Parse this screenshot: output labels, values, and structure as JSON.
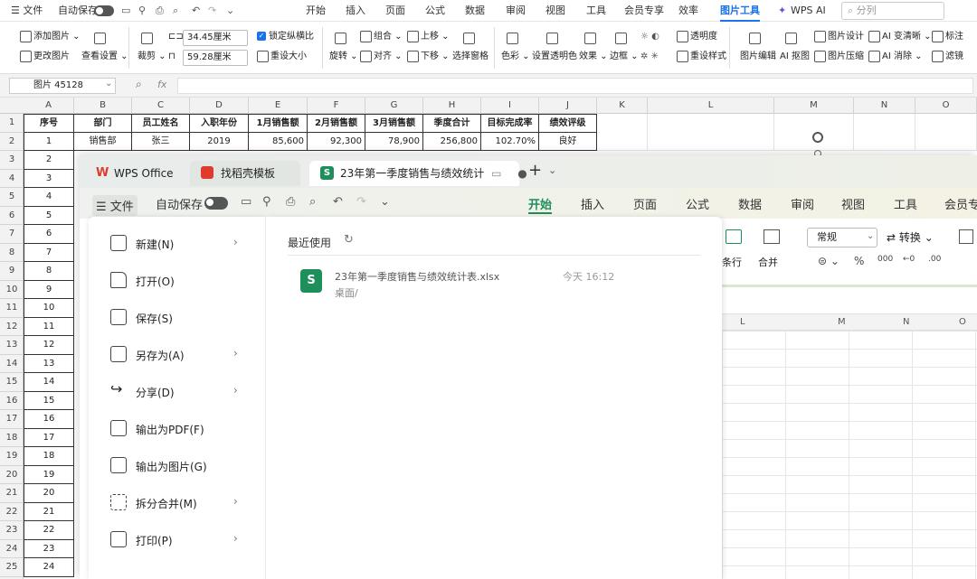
{
  "menubar": {
    "file": "☰ 文件",
    "autosave": "自动保存",
    "tabs": [
      "开始",
      "插入",
      "页面",
      "公式",
      "数据",
      "审阅",
      "视图",
      "工具",
      "会员专享",
      "效率",
      "图片工具",
      "WPS AI"
    ],
    "active_tab": "图片工具",
    "search_placeholder": "分列"
  },
  "ribbon": {
    "add_image": "添加图片",
    "change_image": "更改图片",
    "view_settings": "查看设置",
    "crop": "裁剪",
    "width_value": "34.45厘米",
    "height_value": "59.28厘米",
    "lock_ratio": "锁定纵横比",
    "reset_size": "重设大小",
    "rotate": "旋转",
    "group": "组合",
    "align": "对齐",
    "bring_up": "上移",
    "send_down": "下移",
    "selection_pane": "选择窗格",
    "color": "色彩",
    "set_transparent": "设置透明色",
    "effects": "效果",
    "border": "边框",
    "transparency": "透明度",
    "reset_style": "重设样式",
    "image_edit": "图片编辑",
    "ai_cutout": "AI 抠图",
    "image_design": "图片设计",
    "image_compress": "图片压缩",
    "ai_sharpen": "AI 变清晰",
    "ai_remove": "AI 消除",
    "annotate": "标注",
    "filter": "滤镜"
  },
  "formula_bar": {
    "name_box": "图片 45128",
    "fx": "fx"
  },
  "sheet": {
    "columns": [
      "A",
      "B",
      "C",
      "D",
      "E",
      "F",
      "G",
      "H",
      "I",
      "J",
      "K",
      "L",
      "M",
      "N",
      "O"
    ],
    "rows": [
      "1",
      "2",
      "3",
      "4",
      "5",
      "6",
      "7",
      "8",
      "9",
      "10",
      "11",
      "12",
      "13",
      "14",
      "15",
      "16",
      "17",
      "18",
      "19",
      "20",
      "21",
      "22",
      "23",
      "24",
      "25"
    ],
    "headers": [
      "序号",
      "部门",
      "员工姓名",
      "入职年份",
      "1月销售额",
      "2月销售额",
      "3月销售额",
      "季度合计",
      "目标完成率",
      "绩效评级"
    ],
    "row2": [
      "1",
      "销售部",
      "张三",
      "2019",
      "85,600",
      "92,300",
      "78,900",
      "256,800",
      "102.70%",
      "良好"
    ],
    "col_a": [
      "2",
      "3",
      "4",
      "5",
      "6",
      "7",
      "8",
      "9",
      "10",
      "11",
      "12",
      "13",
      "14",
      "15",
      "16",
      "17",
      "18",
      "19",
      "20",
      "21",
      "22",
      "23",
      "24"
    ]
  },
  "window": {
    "tabs": [
      {
        "label": "WPS Office"
      },
      {
        "label": "找稻壳模板"
      },
      {
        "label": "23年第一季度销售与绩效统计"
      }
    ],
    "new_tab": "+",
    "toolbar": {
      "file": "☰ 文件",
      "autosave": "自动保存",
      "tabs": [
        "开始",
        "插入",
        "页面",
        "公式",
        "数据",
        "审阅",
        "视图",
        "工具",
        "会员专"
      ]
    },
    "file_menu": [
      {
        "label": "新建(N)",
        "arrow": "›"
      },
      {
        "label": "打开(O)",
        "arrow": ""
      },
      {
        "label": "保存(S)",
        "arrow": ""
      },
      {
        "label": "另存为(A)",
        "arrow": "›"
      },
      {
        "label": "分享(D)",
        "arrow": "›"
      },
      {
        "label": "输出为PDF(F)",
        "arrow": ""
      },
      {
        "label": "输出为图片(G)",
        "arrow": ""
      },
      {
        "label": "拆分合并(M)",
        "arrow": "›"
      },
      {
        "label": "打印(P)",
        "arrow": "›"
      }
    ],
    "recent": {
      "title": "最近使用",
      "file_name": "23年第一季度销售与绩效统计表.xlsx",
      "file_path": "桌面/",
      "file_time": "今天 16:12"
    },
    "bg_ribbon": {
      "format": "常规",
      "convert": "转换",
      "wrap": "条行",
      "merge": "合并"
    },
    "bg_cols": [
      "L",
      "M",
      "N",
      "O"
    ]
  },
  "colors": {
    "accent": "#1a73e8",
    "excel_green": "#1e8e5a",
    "wps_red": "#e03a2f"
  }
}
